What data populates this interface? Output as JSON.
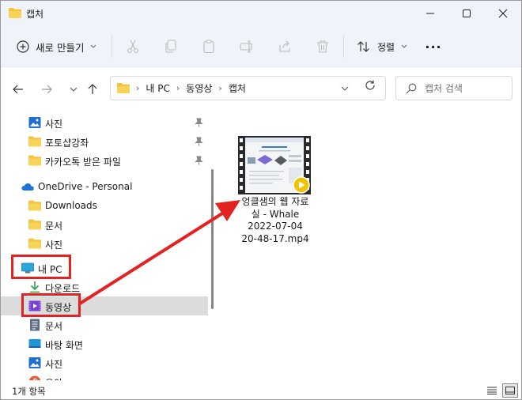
{
  "window": {
    "title": "캡처"
  },
  "toolbar": {
    "new_label": "새로 만들기",
    "sort_label": "정렬",
    "more_label": "···"
  },
  "address": {
    "segments": [
      "내 PC",
      "동영상",
      "캡처"
    ],
    "search_placeholder": "캡처 검색"
  },
  "sidebar": {
    "items": [
      {
        "label": "사진",
        "icon": "photos-icon",
        "pinned": true
      },
      {
        "label": "포토샵강좌",
        "icon": "folder-icon",
        "pinned": true
      },
      {
        "label": "카카오톡 받은 파일",
        "icon": "folder-icon",
        "pinned": true
      },
      {
        "label": "OneDrive - Personal",
        "icon": "cloud-icon",
        "pinned": false
      },
      {
        "label": "Downloads",
        "icon": "folder-icon",
        "pinned": false
      },
      {
        "label": "문서",
        "icon": "folder-icon",
        "pinned": false
      },
      {
        "label": "사진",
        "icon": "folder-icon",
        "pinned": false
      },
      {
        "label": "내 PC",
        "icon": "monitor-icon",
        "pinned": false
      },
      {
        "label": "다운로드",
        "icon": "download-icon",
        "pinned": false
      },
      {
        "label": "동영상",
        "icon": "video-icon",
        "pinned": false,
        "selected": true
      },
      {
        "label": "문서",
        "icon": "document-icon",
        "pinned": false
      },
      {
        "label": "바탕 화면",
        "icon": "desktop-icon",
        "pinned": false
      },
      {
        "label": "사진",
        "icon": "photos-icon",
        "pinned": false
      },
      {
        "label": "음악",
        "icon": "music-icon",
        "pinned": false
      }
    ]
  },
  "content": {
    "files": [
      {
        "name_lines": [
          "엉클샘의 웹 자료",
          "실 - Whale",
          "2022-07-04",
          "20-48-17.mp4"
        ]
      }
    ]
  },
  "status": {
    "item_count": "1개 항목"
  },
  "colors": {
    "accent": "#0067c0",
    "annotation": "#e32222",
    "folder": "#f4c23d",
    "selected_bg": "#dcdcdc"
  }
}
